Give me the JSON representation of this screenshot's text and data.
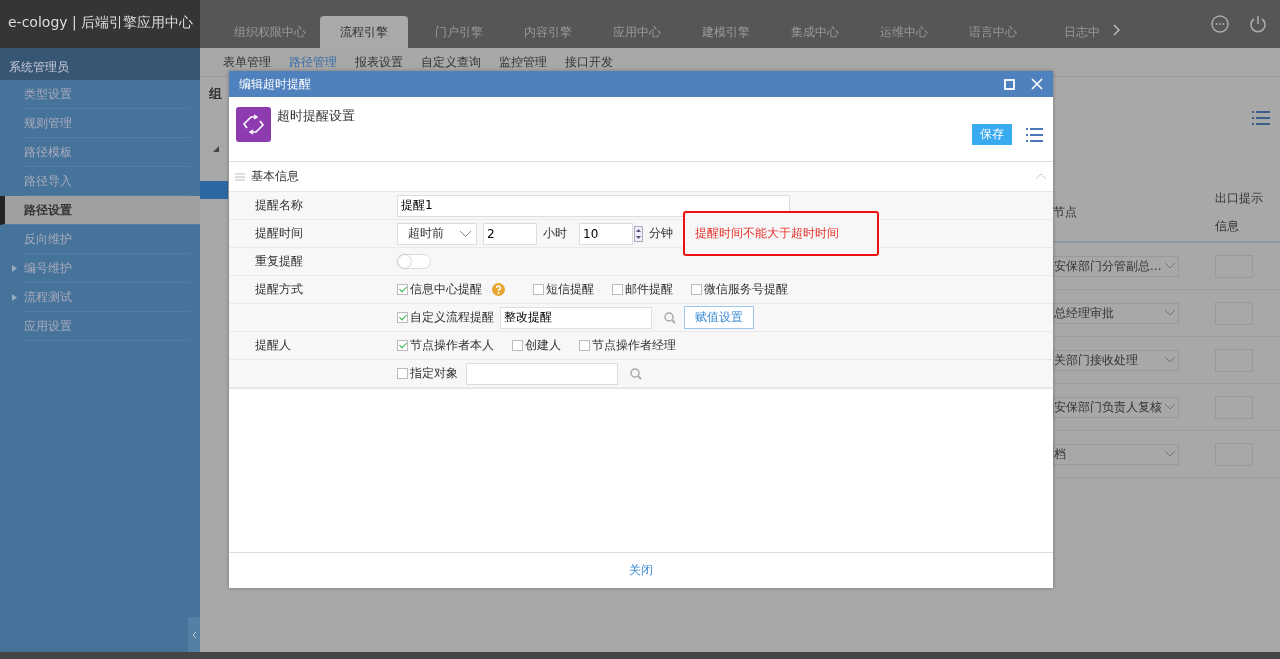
{
  "top_bar": {
    "logo": "e-cology | 后端引擎应用中心",
    "tabs": [
      {
        "label": "组织权限中心",
        "selected": false
      },
      {
        "label": "流程引擎",
        "selected": true
      },
      {
        "label": "门户引擎",
        "selected": false
      },
      {
        "label": "内容引擎",
        "selected": false
      },
      {
        "label": "应用中心",
        "selected": false
      },
      {
        "label": "建模引擎",
        "selected": false
      },
      {
        "label": "集成中心",
        "selected": false
      },
      {
        "label": "运维中心",
        "selected": false
      },
      {
        "label": "语言中心",
        "selected": false
      },
      {
        "label": "日志中",
        "selected": false
      }
    ]
  },
  "sidebar": {
    "header": "系统管理员",
    "items": [
      {
        "label": "类型设置",
        "selected": false,
        "expandable": false
      },
      {
        "label": "规则管理",
        "selected": false,
        "expandable": false
      },
      {
        "label": "路径模板",
        "selected": false,
        "expandable": false
      },
      {
        "label": "路径导入",
        "selected": false,
        "expandable": false
      },
      {
        "label": "路径设置",
        "selected": true,
        "expandable": false
      },
      {
        "label": "反向维护",
        "selected": false,
        "expandable": false
      },
      {
        "label": "编号维护",
        "selected": false,
        "expandable": true
      },
      {
        "label": "流程测试",
        "selected": false,
        "expandable": true
      },
      {
        "label": "应用设置",
        "selected": false,
        "expandable": false
      }
    ]
  },
  "subnav": [
    {
      "label": "表单管理",
      "selected": false
    },
    {
      "label": "路径管理",
      "selected": true
    },
    {
      "label": "报表设置",
      "selected": false
    },
    {
      "label": "自定义查询",
      "selected": false
    },
    {
      "label": "监控管理",
      "selected": false
    },
    {
      "label": "接口开发",
      "selected": false
    }
  ],
  "page_title": "组",
  "background_table": {
    "columns": [
      "节点",
      "出口提示信息"
    ],
    "rows": [
      {
        "node": "安保部门分管副总..."
      },
      {
        "node": "总经理审批"
      },
      {
        "node": "关部门接收处理"
      },
      {
        "node": "安保部门负责人复核"
      },
      {
        "node": "档"
      }
    ]
  },
  "dialog": {
    "title": "编辑超时提醒",
    "header_title": "超时提醒设置",
    "save": "保存",
    "section": "基本信息",
    "name": {
      "label": "提醒名称",
      "value": "提醒1"
    },
    "time": {
      "label": "提醒时间",
      "mode": "超时前",
      "hours": "2",
      "hours_unit": "小时",
      "minutes": "10",
      "minutes_unit": "分钟",
      "error": "提醒时间不能大于超时时间"
    },
    "repeat": {
      "label": "重复提醒",
      "on": false
    },
    "methods": {
      "label": "提醒方式",
      "options": [
        {
          "label": "信息中心提醒",
          "checked": true,
          "help": true
        },
        {
          "label": "短信提醒",
          "checked": false,
          "help": false
        },
        {
          "label": "邮件提醒",
          "checked": false,
          "help": false
        },
        {
          "label": "微信服务号提醒",
          "checked": false,
          "help": false
        }
      ],
      "custom": {
        "label": "自定义流程提醒",
        "checked": true,
        "value": "整改提醒",
        "button": "赋值设置"
      }
    },
    "recipients": {
      "label": "提醒人",
      "options": [
        {
          "label": "节点操作者本人",
          "checked": true
        },
        {
          "label": "创建人",
          "checked": false
        },
        {
          "label": "节点操作者经理",
          "checked": false
        }
      ],
      "specific": {
        "label": "指定对象",
        "checked": false
      }
    },
    "close": "关闭"
  }
}
